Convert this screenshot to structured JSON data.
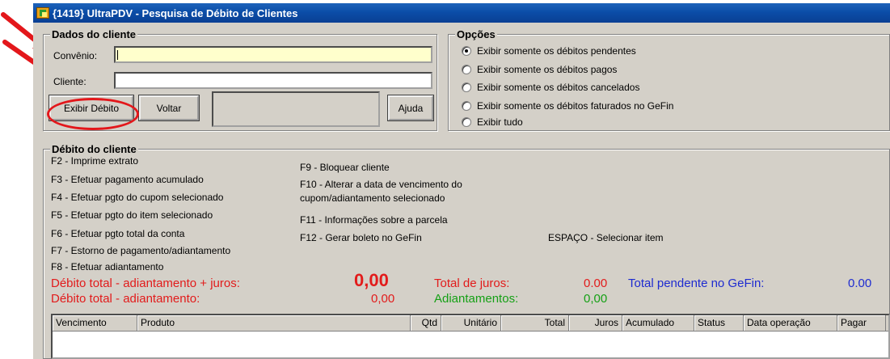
{
  "window": {
    "title": "{1419} UltraPDV - Pesquisa de Débito de Clientes"
  },
  "dados": {
    "title": "Dados do cliente",
    "convenio_label": "Convênio:",
    "convenio_value": "",
    "cliente_label": "Cliente:",
    "cliente_value": "",
    "btn_exibir": "Exibir Débito",
    "btn_voltar": "Voltar",
    "btn_ajuda": "Ajuda"
  },
  "opcoes": {
    "title": "Opções",
    "items": [
      {
        "label": "Exibir somente os débitos pendentes",
        "checked": true
      },
      {
        "label": "Exibir somente os débitos pagos",
        "checked": false
      },
      {
        "label": "Exibir somente os débitos cancelados",
        "checked": false
      },
      {
        "label": "Exibir somente os débitos faturados no GeFin",
        "checked": false
      },
      {
        "label": "Exibir tudo",
        "checked": false
      }
    ]
  },
  "debito": {
    "title": "Débito do cliente",
    "left_keys": [
      "F2 - Imprime extrato",
      "F3 - Efetuar pagamento acumulado",
      "F4 - Efetuar pgto do cupom selecionado",
      "F5 - Efetuar pgto do item selecionado",
      "F6 - Efetuar pgto total da conta",
      "F7 - Estorno de pagamento/adiantamento",
      "F8 - Efetuar adiantamento"
    ],
    "f9": "F9 - Bloquear cliente",
    "f10_a": "F10 - Alterar a data de vencimento do",
    "f10_b": "cupom/adiantamento selecionado",
    "f11": "F11 - Informações sobre a parcela",
    "f12": "F12 - Gerar boleto no GeFin",
    "espaco": "ESPAÇO - Selecionar item"
  },
  "totals": {
    "deb_juros_label": "Débito total - adiantamento + juros:",
    "deb_juros_value": "0,00",
    "deb_label": "Débito total - adiantamento:",
    "deb_value": "0,00",
    "juros_label": "Total de juros:",
    "juros_value": "0.00",
    "adiant_label": "Adiantamentos:",
    "adiant_value": "0,00",
    "gefin_label": "Total pendente no GeFin:",
    "gefin_value": "0.00"
  },
  "grid": {
    "columns": [
      "Vencimento",
      "Produto",
      "Qtd",
      "Unitário",
      "Total",
      "Juros",
      "Acumulado",
      "Status",
      "Data operação",
      "Pagar"
    ]
  },
  "colors": {
    "titlebar": "#0b4da8",
    "red": "#e21b1b",
    "green": "#15a015",
    "blue": "#1e2bd0",
    "annotation": "#e3171b"
  }
}
